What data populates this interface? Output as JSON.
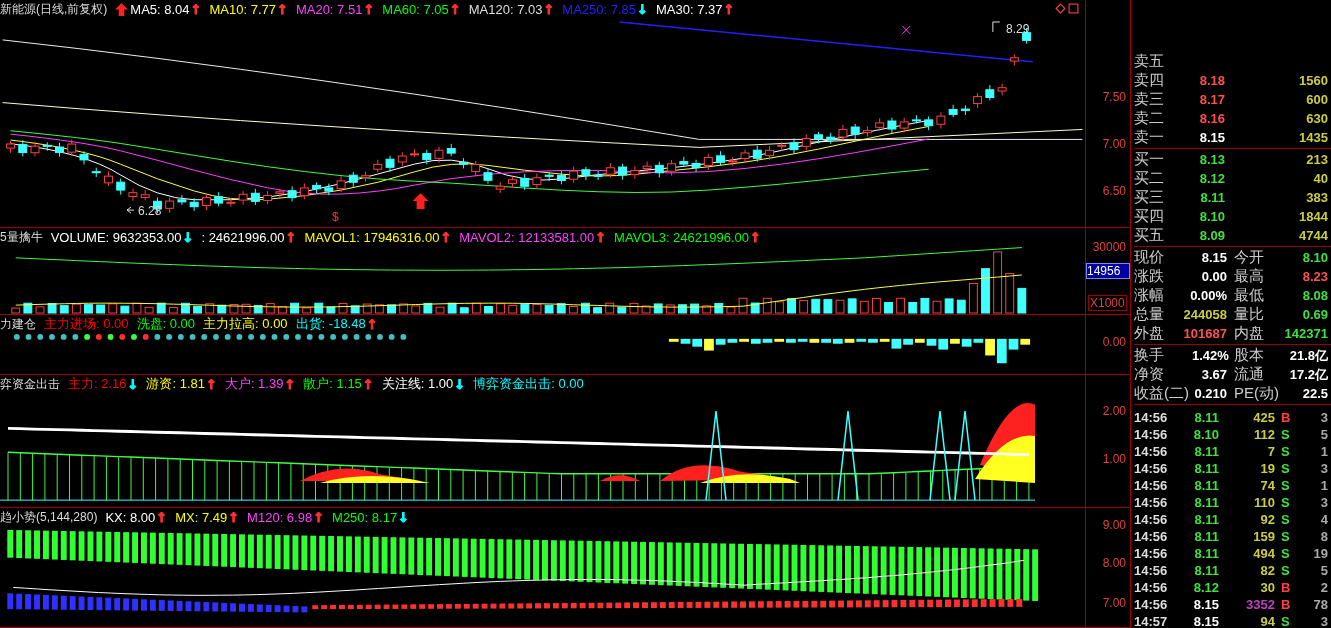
{
  "price_panel": {
    "title": "新能源(日线,前复权)",
    "indicators": [
      {
        "text": "MA5: 8.04",
        "color": "#ffffff",
        "arrow": {
          "text": "↑",
          "color": "#ff3030"
        }
      },
      {
        "text": "MA10: 7.77",
        "color": "#ffff00",
        "arrow": {
          "text": "↑",
          "color": "#ff3030"
        }
      },
      {
        "text": "MA20: 7.51",
        "color": "#ff40ff",
        "arrow": {
          "text": "↑",
          "color": "#ff3030"
        }
      },
      {
        "text": "MA60: 7.05",
        "color": "#00ff00",
        "arrow": {
          "text": "↑",
          "color": "#ff3030"
        }
      },
      {
        "text": "MA120: 7.03",
        "color": "#dddddd",
        "arrow": {
          "text": "↑",
          "color": "#ff3030"
        }
      },
      {
        "text": "MA250: 7.85",
        "color": "#2020ff",
        "arrow": {
          "text": "↓",
          "color": "#00ffff"
        }
      },
      {
        "text": "MA30: 7.37",
        "color": "#ffffff",
        "arrow": {
          "text": "↑",
          "color": "#ff3030"
        }
      }
    ],
    "low_label": "6.28",
    "high_label": "8.29",
    "signal_mark": "$",
    "axis": [
      "7.50",
      "7.00",
      "6.50"
    ]
  },
  "volume_panel": {
    "title": "5量擒牛",
    "indicators": [
      {
        "text": "VOLUME: 9632353.00",
        "color": "#ffffff",
        "arrow": {
          "text": "↓",
          "color": "#00ffff"
        }
      },
      {
        "text": ": 24621996.00",
        "color": "#ffffff",
        "arrow": {
          "text": "↑",
          "color": "#ff3030"
        }
      },
      {
        "text": "MAVOL1: 17946316.00",
        "color": "#ffff00",
        "arrow": {
          "text": "↑",
          "color": "#ff3030"
        }
      },
      {
        "text": "MAVOL2: 12133581.00",
        "color": "#ff40ff",
        "arrow": {
          "text": "↑",
          "color": "#ff3030"
        }
      },
      {
        "text": "MAVOL3: 24621996.00",
        "color": "#00ff00",
        "arrow": {
          "text": "↑",
          "color": "#ff3030"
        }
      }
    ],
    "axis": [
      "30000"
    ],
    "cursor_value": "14956",
    "scale": "X1000"
  },
  "fund_panel": {
    "title": "力建仓",
    "indicators": [
      {
        "text": "主力进场: 0.00",
        "color": "#ff0000"
      },
      {
        "text": "洗盘: 0.00",
        "color": "#00ff00"
      },
      {
        "text": "主力拉高: 0.00",
        "color": "#ffff00"
      },
      {
        "text": "出货: -18.48",
        "color": "#00ffff",
        "arrow": {
          "text": "↑",
          "color": "#ff3030"
        }
      }
    ],
    "axis": [
      "0.00"
    ]
  },
  "game_panel": {
    "title": "弈资金出击",
    "indicators": [
      {
        "text": "主力: 2.16",
        "color": "#ff0000",
        "arrow": {
          "text": "↓",
          "color": "#00ffff"
        }
      },
      {
        "text": "游资: 1.81",
        "color": "#ffff00",
        "arrow": {
          "text": "↑",
          "color": "#ff3030"
        }
      },
      {
        "text": "大户: 1.39",
        "color": "#ff40ff",
        "arrow": {
          "text": "↑",
          "color": "#ff3030"
        }
      },
      {
        "text": "散户: 1.15",
        "color": "#00ff00",
        "arrow": {
          "text": "↑",
          "color": "#ff3030"
        }
      },
      {
        "text": "关注线: 1.00",
        "color": "#ffffff",
        "arrow": {
          "text": "↓",
          "color": "#00ffff"
        }
      },
      {
        "text": "博弈资金出击: 0.00",
        "color": "#00ffff"
      }
    ],
    "axis": [
      "2.00",
      "1.00"
    ]
  },
  "trend_panel": {
    "title": "趋小势(5,144,280)",
    "indicators": [
      {
        "text": "KX: 8.00",
        "color": "#ffffff",
        "arrow": {
          "text": "↑",
          "color": "#ff3030"
        }
      },
      {
        "text": "MX: 7.49",
        "color": "#ffff00",
        "arrow": {
          "text": "↑",
          "color": "#ff3030"
        }
      },
      {
        "text": "M120: 6.98",
        "color": "#ff40ff",
        "arrow": {
          "text": "↑",
          "color": "#ff3030"
        }
      },
      {
        "text": "M250: 8.17",
        "color": "#00ff00",
        "arrow": {
          "text": "↓",
          "color": "#00ffff"
        }
      }
    ],
    "axis": [
      "9.00",
      "8.00",
      "7.00"
    ]
  },
  "order_book": {
    "asks": [
      {
        "label": "卖五"
      },
      {
        "label": "卖四",
        "price": "8.18",
        "volume": "1560",
        "color": "#ff5050"
      },
      {
        "label": "卖三",
        "price": "8.17",
        "volume": "600",
        "color": "#ff5050"
      },
      {
        "label": "卖二",
        "price": "8.16",
        "volume": "630",
        "color": "#ff5050"
      },
      {
        "label": "卖一",
        "price": "8.15",
        "volume": "1435",
        "color": "#ffffff"
      }
    ],
    "bids": [
      {
        "label": "买一",
        "price": "8.13",
        "volume": "213",
        "color": "#40e040"
      },
      {
        "label": "买二",
        "price": "8.12",
        "volume": "40",
        "color": "#40e040"
      },
      {
        "label": "买三",
        "price": "8.11",
        "volume": "383",
        "color": "#40e040"
      },
      {
        "label": "买四",
        "price": "8.10",
        "volume": "1844",
        "color": "#40e040"
      },
      {
        "label": "买五",
        "price": "8.09",
        "volume": "4744",
        "color": "#40e040"
      }
    ]
  },
  "quote": [
    {
      "left": {
        "label": "现价",
        "value": "8.15",
        "color": "#ffffff"
      },
      "right": {
        "label": "今开",
        "value": "8.10",
        "color": "#40e040"
      }
    },
    {
      "left": {
        "label": "涨跌",
        "value": "0.00",
        "color": "#ffffff"
      },
      "right": {
        "label": "最高",
        "value": "8.23",
        "color": "#ff5050"
      }
    },
    {
      "left": {
        "label": "涨幅",
        "value": "0.00%",
        "color": "#ffffff"
      },
      "right": {
        "label": "最低",
        "value": "8.08",
        "color": "#40e040"
      }
    },
    {
      "left": {
        "label": "总量",
        "value": "244058",
        "color": "#cccc40"
      },
      "right": {
        "label": "量比",
        "value": "0.69",
        "color": "#40e040"
      }
    },
    {
      "left": {
        "label": "外盘",
        "value": "101687",
        "color": "#ff5050"
      },
      "right": {
        "label": "内盘",
        "value": "142371",
        "color": "#40e040"
      }
    }
  ],
  "fundamentals": [
    {
      "label": "换手",
      "value": "1.42%",
      "label2": "股本",
      "value2": "21.8亿"
    },
    {
      "label": "净资",
      "value": "3.67",
      "label2": "流通",
      "value2": "17.2亿"
    },
    {
      "label": "收益(二)",
      "value": "0.210",
      "label2": "PE(动)",
      "value2": "22.5"
    }
  ],
  "ticks": [
    {
      "time": "14:56",
      "price": {
        "text": "8.11",
        "color": "#40e040"
      },
      "volume": {
        "text": "425",
        "color": "#cccc40"
      },
      "side": {
        "text": "B",
        "color": "#ff4040"
      },
      "count": "3"
    },
    {
      "time": "14:56",
      "price": {
        "text": "8.10",
        "color": "#40e040"
      },
      "volume": {
        "text": "112",
        "color": "#cccc40"
      },
      "side": {
        "text": "S",
        "color": "#40e040"
      },
      "count": "5"
    },
    {
      "time": "14:56",
      "price": {
        "text": "8.11",
        "color": "#40e040"
      },
      "volume": {
        "text": "7",
        "color": "#cccc40"
      },
      "side": {
        "text": "S",
        "color": "#40e040"
      },
      "count": "1"
    },
    {
      "time": "14:56",
      "price": {
        "text": "8.11",
        "color": "#40e040"
      },
      "volume": {
        "text": "19",
        "color": "#cccc40"
      },
      "side": {
        "text": "S",
        "color": "#40e040"
      },
      "count": "3"
    },
    {
      "time": "14:56",
      "price": {
        "text": "8.11",
        "color": "#40e040"
      },
      "volume": {
        "text": "74",
        "color": "#cccc40"
      },
      "side": {
        "text": "S",
        "color": "#40e040"
      },
      "count": "1"
    },
    {
      "time": "14:56",
      "price": {
        "text": "8.11",
        "color": "#40e040"
      },
      "volume": {
        "text": "110",
        "color": "#cccc40"
      },
      "side": {
        "text": "S",
        "color": "#40e040"
      },
      "count": "3"
    },
    {
      "time": "14:56",
      "price": {
        "text": "8.11",
        "color": "#40e040"
      },
      "volume": {
        "text": "92",
        "color": "#cccc40"
      },
      "side": {
        "text": "S",
        "color": "#40e040"
      },
      "count": "4"
    },
    {
      "time": "14:56",
      "price": {
        "text": "8.11",
        "color": "#40e040"
      },
      "volume": {
        "text": "159",
        "color": "#cccc40"
      },
      "side": {
        "text": "S",
        "color": "#40e040"
      },
      "count": "8"
    },
    {
      "time": "14:56",
      "price": {
        "text": "8.11",
        "color": "#40e040"
      },
      "volume": {
        "text": "494",
        "color": "#cccc40"
      },
      "side": {
        "text": "S",
        "color": "#40e040"
      },
      "count": "19"
    },
    {
      "time": "14:56",
      "price": {
        "text": "8.11",
        "color": "#40e040"
      },
      "volume": {
        "text": "82",
        "color": "#cccc40"
      },
      "side": {
        "text": "S",
        "color": "#40e040"
      },
      "count": "5"
    },
    {
      "time": "14:56",
      "price": {
        "text": "8.12",
        "color": "#40e040"
      },
      "volume": {
        "text": "30",
        "color": "#cccc40"
      },
      "side": {
        "text": "B",
        "color": "#ff4040"
      },
      "count": "2"
    },
    {
      "time": "14:56",
      "price": {
        "text": "8.15",
        "color": "#ffffff"
      },
      "volume": {
        "text": "3352",
        "color": "#c040c0"
      },
      "side": {
        "text": "B",
        "color": "#ff4040"
      },
      "count": "78"
    },
    {
      "time": "14:57",
      "price": {
        "text": "8.15",
        "color": "#ffffff"
      },
      "volume": {
        "text": "94",
        "color": "#cccc40"
      },
      "side": {
        "text": "S",
        "color": "#40e040"
      },
      "count": "3"
    }
  ]
}
